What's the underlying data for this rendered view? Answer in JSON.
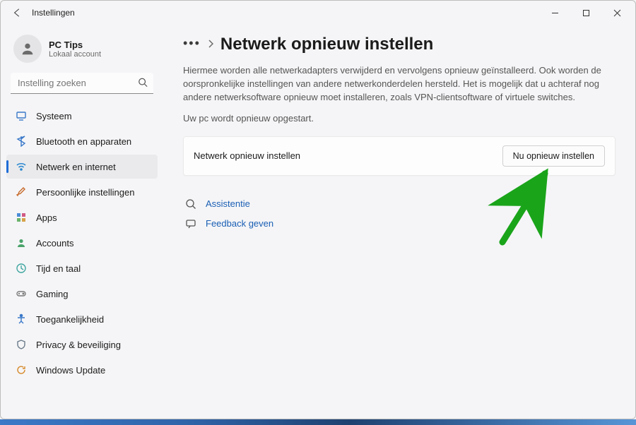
{
  "titlebar": {
    "title": "Instellingen"
  },
  "account": {
    "name": "PC Tips",
    "sub": "Lokaal account"
  },
  "search": {
    "placeholder": "Instelling zoeken"
  },
  "nav": {
    "items": [
      {
        "label": "Systeem"
      },
      {
        "label": "Bluetooth en apparaten"
      },
      {
        "label": "Netwerk en internet"
      },
      {
        "label": "Persoonlijke instellingen"
      },
      {
        "label": "Apps"
      },
      {
        "label": "Accounts"
      },
      {
        "label": "Tijd en taal"
      },
      {
        "label": "Gaming"
      },
      {
        "label": "Toegankelijkheid"
      },
      {
        "label": "Privacy & beveiliging"
      },
      {
        "label": "Windows Update"
      }
    ]
  },
  "page": {
    "title": "Netwerk opnieuw instellen",
    "desc": "Hiermee worden alle netwerkadapters verwijderd en vervolgens opnieuw geïnstalleerd. Ook worden de oorspronkelijke instellingen van andere netwerkonderdelen hersteld. Het is mogelijk dat u achteraf nog andere netwerksoftware opnieuw moet installeren, zoals VPN-clientsoftware of virtuele switches.",
    "desc2": "Uw pc wordt opnieuw opgestart.",
    "card_title": "Netwerk opnieuw instellen",
    "card_button": "Nu opnieuw instellen",
    "links": {
      "help": "Assistentie",
      "feedback": "Feedback geven"
    }
  },
  "colors": {
    "accent": "#1f6cd6",
    "arrow": "#1aa41a"
  }
}
